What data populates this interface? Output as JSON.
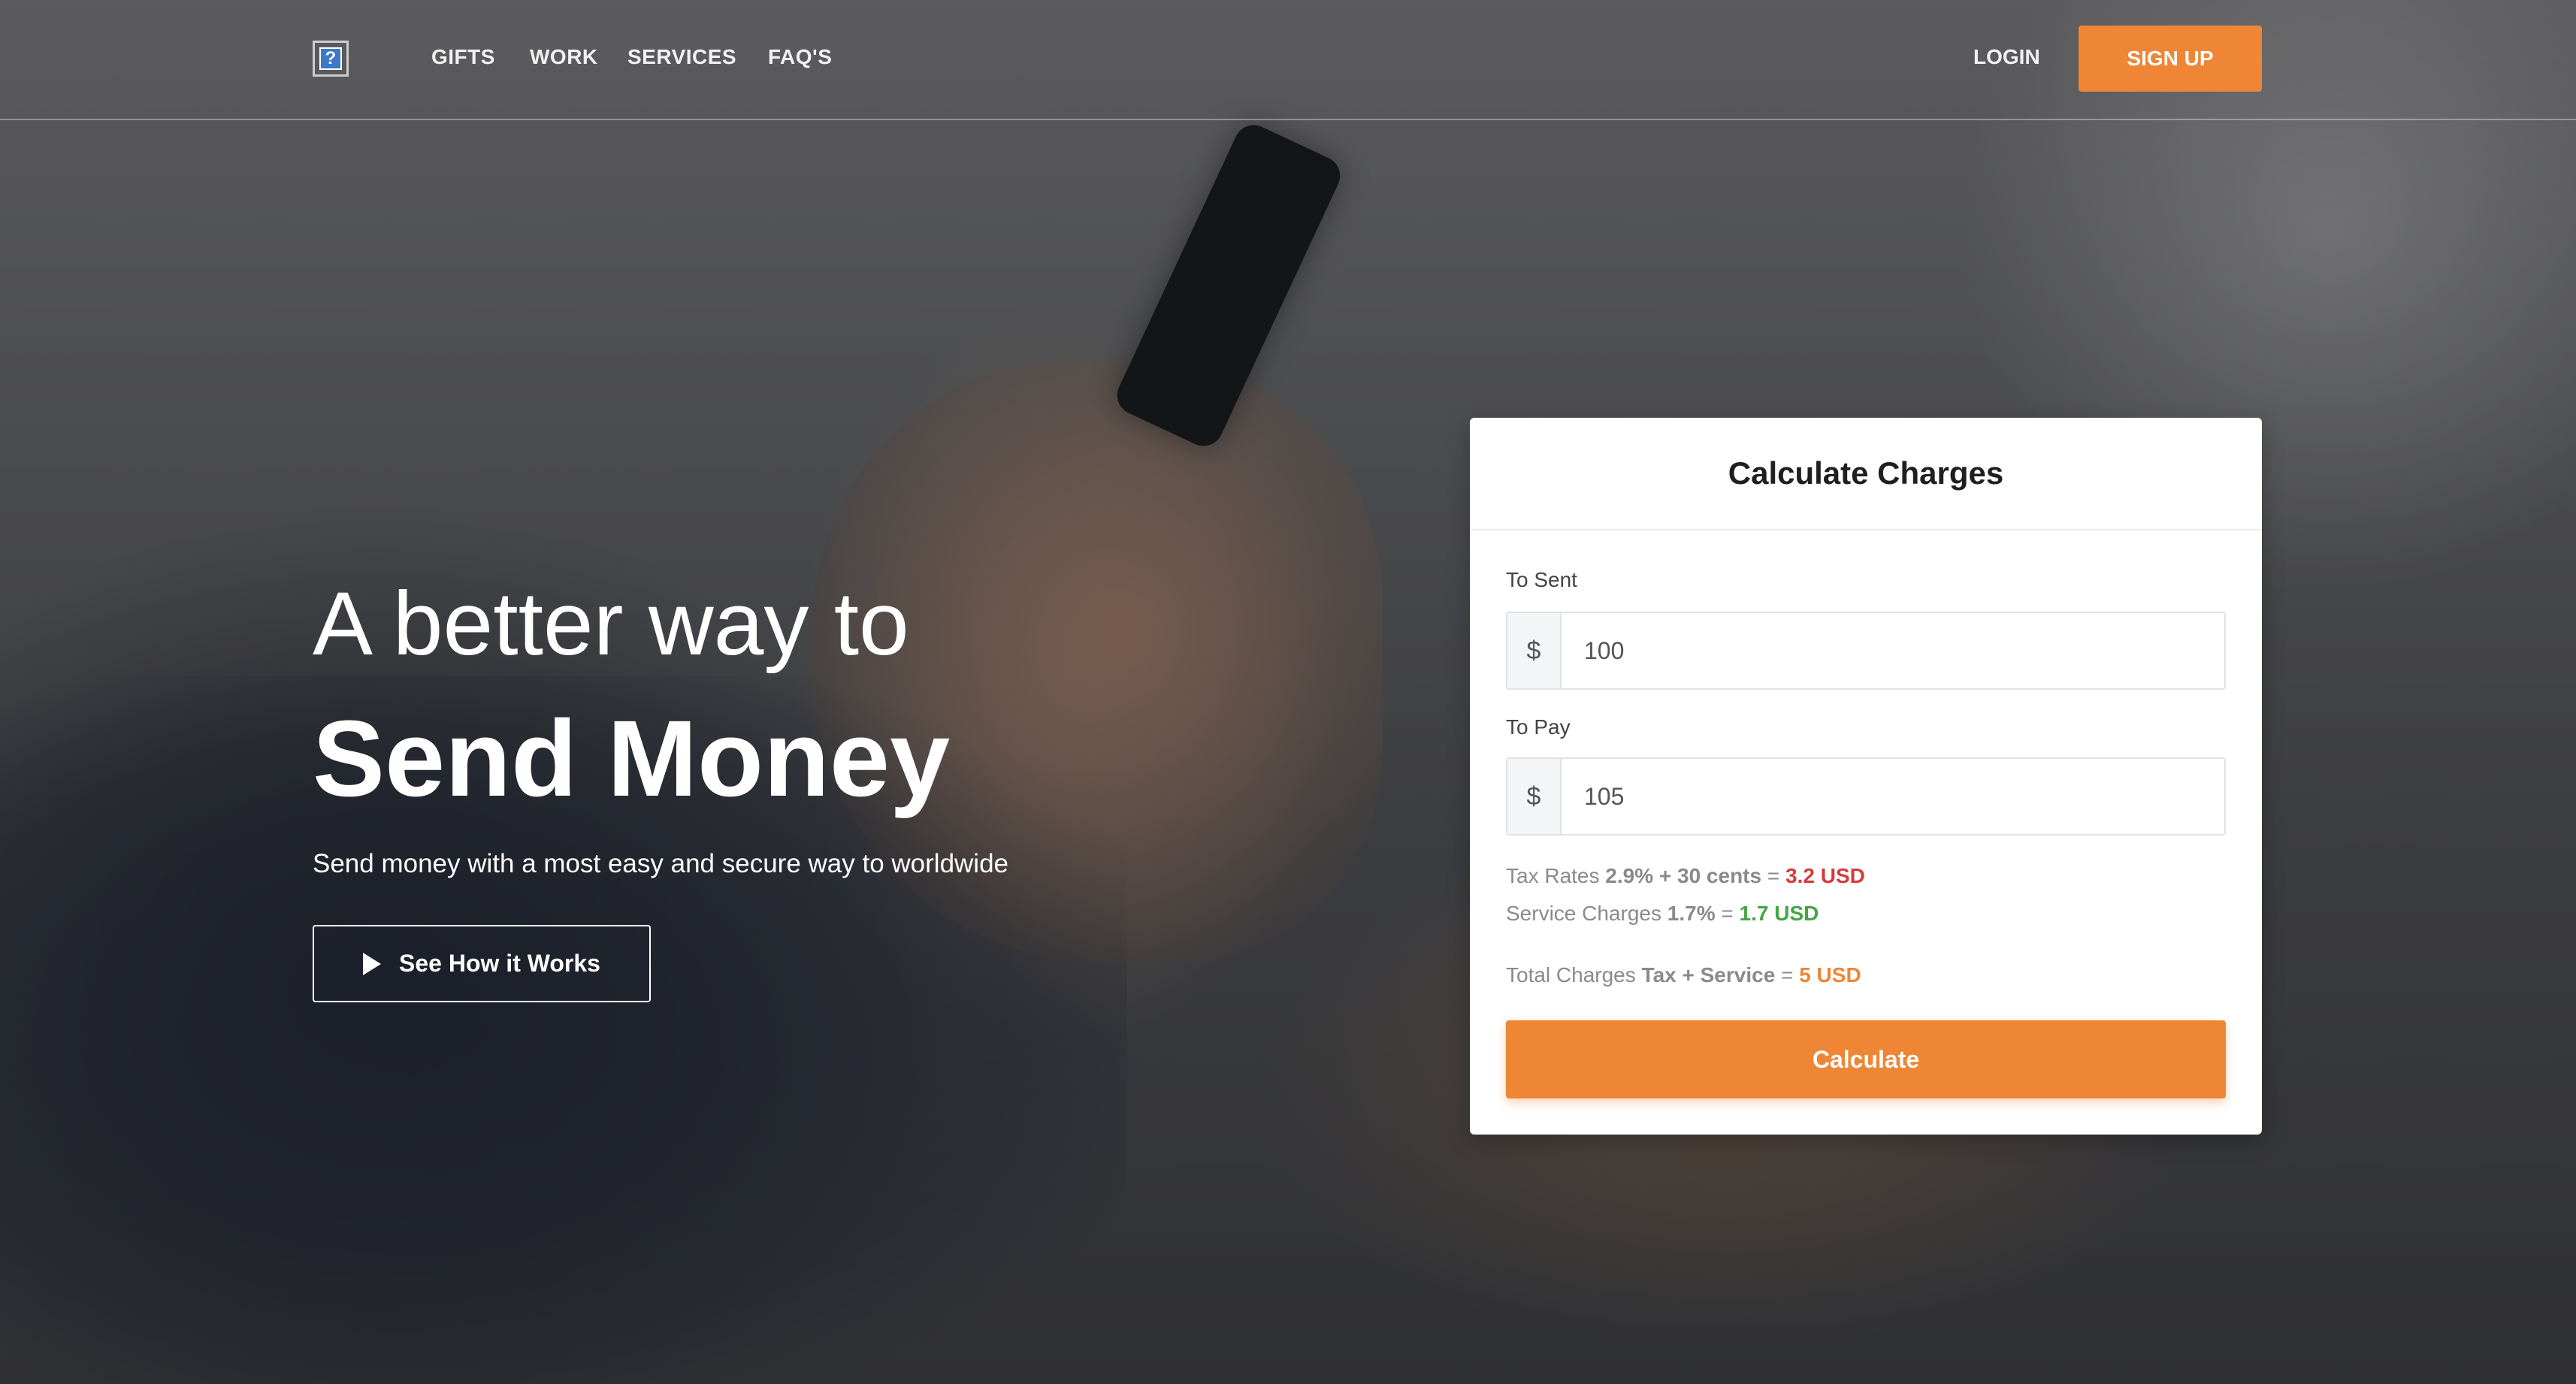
{
  "nav": {
    "logo_glyph": "?",
    "links": [
      "GIFTS",
      "WORK",
      "SERVICES",
      "FAQ'S"
    ],
    "login": "LOGIN",
    "signup": "SIGN UP"
  },
  "hero": {
    "line1": "A better way to",
    "line2": "Send Money",
    "subtitle": "Send money with a most easy and secure way to worldwide",
    "cta": "See How it Works"
  },
  "calculator": {
    "title": "Calculate Charges",
    "to_sent_label": "To Sent",
    "to_sent_currency": "$",
    "to_sent_value": "100",
    "to_pay_label": "To Pay",
    "to_pay_currency": "$",
    "to_pay_value": "105",
    "tax": {
      "label": "Tax Rates",
      "rate": "2.9% + 30 cents",
      "equals": "=",
      "result": "3.2 USD"
    },
    "service": {
      "label": "Service Charges",
      "rate": "1.7%",
      "equals": "=",
      "result": "1.7 USD"
    },
    "total": {
      "label": "Total Charges",
      "formula": "Tax + Service",
      "equals": "=",
      "result": "5 USD"
    },
    "button": "Calculate"
  },
  "colors": {
    "accent": "#ee8636",
    "tax_result": "#d63b3b",
    "service_result": "#45a545"
  }
}
